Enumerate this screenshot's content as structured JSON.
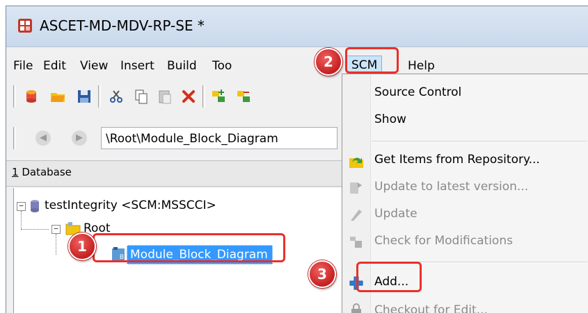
{
  "window": {
    "title": "ASCET-MD-MDV-RP-SE *"
  },
  "menubar": {
    "items": [
      "File",
      "Edit",
      "View",
      "Insert",
      "Build",
      "Too",
      "SCM",
      "Help"
    ]
  },
  "toolbar": {
    "icons": [
      "database-icon",
      "open-folder-icon",
      "save-icon",
      "cut-icon",
      "copy-icon",
      "paste-icon",
      "delete-icon",
      "add-component-icon",
      "remove-component-icon"
    ]
  },
  "addressbar": {
    "back": "◀",
    "forward": "▶",
    "path": "\\Root\\Module_Block_Diagram"
  },
  "panel": {
    "title_prefix": "1",
    "title_rest": " Database"
  },
  "tree": {
    "root": "testIntegrity <SCM:MSSCCI>",
    "folder": "Root",
    "item": "Module_Block_Diagram",
    "expander_symbol": "−"
  },
  "dropdown": {
    "items": [
      {
        "label": "Source Control",
        "enabled": true,
        "icon": ""
      },
      {
        "label": "Show",
        "enabled": true,
        "icon": ""
      },
      {
        "label": "Get Items from Repository...",
        "enabled": true,
        "icon": "get-items-icon"
      },
      {
        "label": "Update to latest version...",
        "enabled": false,
        "icon": "update-latest-icon"
      },
      {
        "label": "Update",
        "enabled": false,
        "icon": "update-icon"
      },
      {
        "label": "Check for Modifications",
        "enabled": false,
        "icon": "check-modifications-icon"
      },
      {
        "label": "Add...",
        "enabled": true,
        "icon": "add-icon"
      },
      {
        "label": "Checkout for Edit...",
        "enabled": false,
        "icon": "checkout-icon"
      }
    ]
  },
  "callouts": [
    "1",
    "2",
    "3"
  ],
  "colors": {
    "selection": "#3399ff",
    "callout": "#d32f2f",
    "highlight": "#e8302a"
  }
}
